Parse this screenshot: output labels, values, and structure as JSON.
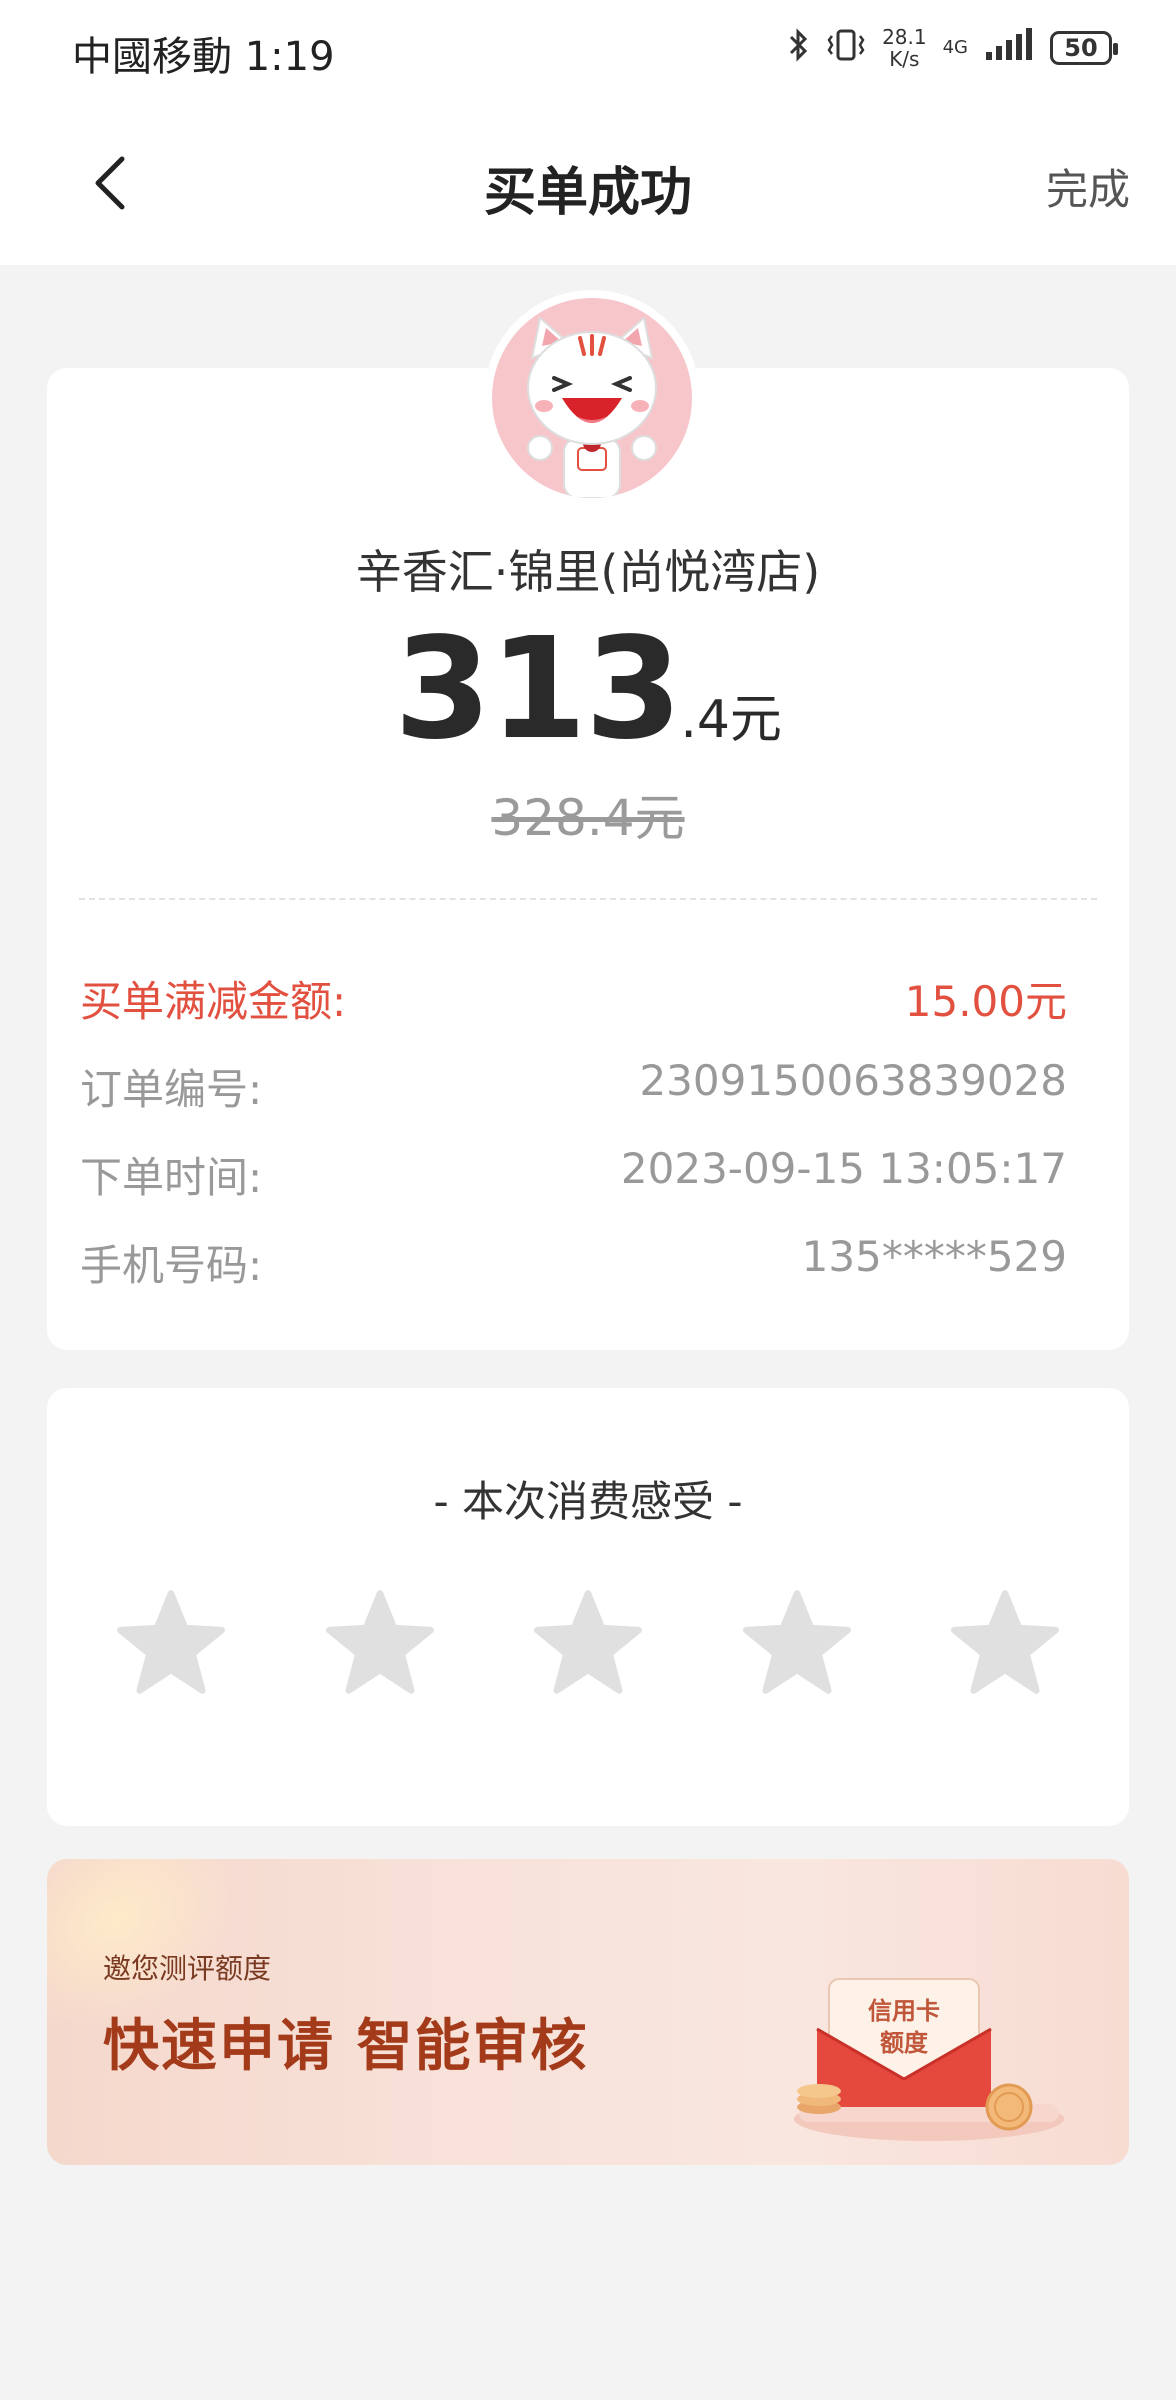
{
  "status_bar": {
    "carrier_time": "中國移動 1:19",
    "net_speed": "28.1",
    "net_speed_unit": "K/s",
    "network": "4G",
    "battery": "50"
  },
  "nav": {
    "title": "买单成功",
    "done_label": "完成"
  },
  "order": {
    "merchant": "辛香汇·锦里(尚悦湾店)",
    "amount_integer": "313",
    "amount_decimal": ".4元",
    "original_price": "328.4元",
    "rows": [
      {
        "label": "买单满减金额:",
        "value": "15.00元"
      },
      {
        "label": "订单编号:",
        "value": "2309150063839028"
      },
      {
        "label": "下单时间:",
        "value": "2023-09-15 13:05:17"
      },
      {
        "label": "手机号码:",
        "value": "135*****529"
      }
    ]
  },
  "rating": {
    "title": "- 本次消费感受 -",
    "max_stars": 5,
    "selected_stars": 0
  },
  "banner": {
    "subtitle": "邀您测评额度",
    "title": "快速申请 智能审核",
    "card_text_line1": "信用卡",
    "card_text_line2": "额度"
  },
  "colors": {
    "accent_red": "#e25040",
    "star_gray": "#e0e0e0",
    "banner_title": "#a33a1a"
  }
}
